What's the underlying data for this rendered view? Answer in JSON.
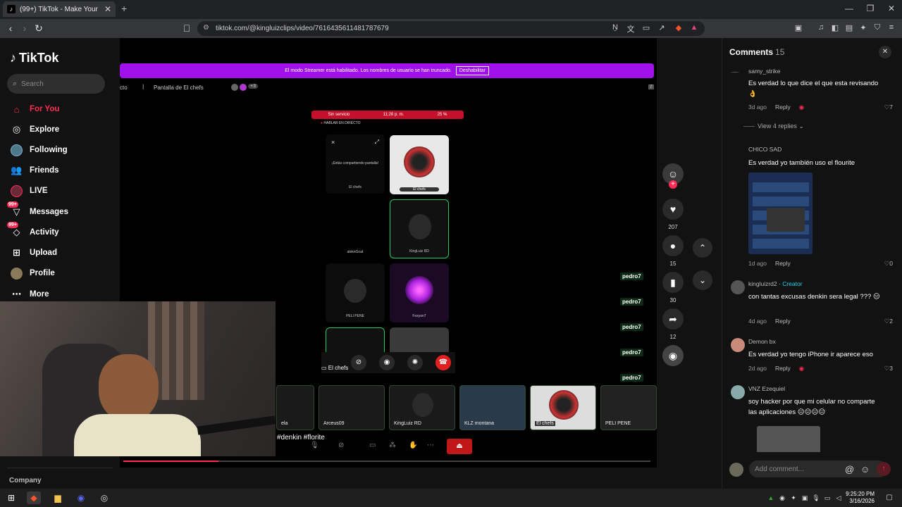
{
  "browser": {
    "tab_title": "(99+) TikTok - Make Your Day",
    "url": "tiktok.com/@kingluizclips/video/7616435611481787679",
    "new_tab": "+",
    "win_min": "—",
    "win_max": "❐",
    "win_close": "✕"
  },
  "sidebar": {
    "logo": "TikTok",
    "search_placeholder": "Search",
    "items": [
      {
        "label": "For You",
        "icon": "home-icon"
      },
      {
        "label": "Explore",
        "icon": "compass-icon"
      },
      {
        "label": "Following",
        "icon": "following-avatar-icon"
      },
      {
        "label": "Friends",
        "icon": "friends-icon"
      },
      {
        "label": "LIVE",
        "icon": "live-icon"
      },
      {
        "label": "Messages",
        "icon": "messages-icon",
        "badge": "99+"
      },
      {
        "label": "Activity",
        "icon": "activity-icon",
        "badge": "99+"
      },
      {
        "label": "Upload",
        "icon": "upload-icon"
      },
      {
        "label": "Profile",
        "icon": "profile-avatar-icon"
      },
      {
        "label": "More",
        "icon": "more-icon"
      }
    ],
    "company": "Company"
  },
  "video": {
    "banner_text": "El modo Streamer está habilitado. Los nombres de usuario se han truncado.",
    "banner_button": "Deshabilitar",
    "stream_left": "cto",
    "screen_label": "Pantalla de El chefs",
    "viewer_extra": "+3",
    "corner_badge": "7",
    "phone_status_left": "Sin servicio",
    "phone_status_time": "11:28 p. m.",
    "phone_status_right": "25 %",
    "hablar": "HABLAR EN DIRECTO",
    "sharing_text": "¡Estás compartiendo pantalla!",
    "sharing_user": "El chefs",
    "tile_el_chefs": "El chefs",
    "tile_kingluiz": "KingLuiz RD",
    "tile_alekn": "aleknGoat",
    "tile_peli": "PELI PENE",
    "tile_foxyon": "Foxyon7",
    "call_name": "El chefs",
    "strip_names": [
      "pedro7",
      "pedro7",
      "pedro7",
      "pedro7",
      "pedro7"
    ],
    "bottom_tiles": [
      "ela",
      "Arceus09",
      "KingLuiz RD",
      "KLZ montana",
      "El chefs",
      "PELI PENE"
    ],
    "hashtags": "#denkin #florite"
  },
  "actions": {
    "likes": "207",
    "comments": "15",
    "saves": "30",
    "shares": "12"
  },
  "comments_panel": {
    "title": "Comments",
    "count": "15",
    "view_replies": "View 4 replies",
    "reply": "Reply",
    "creator_label": "Creator",
    "add_placeholder": "Add comment...",
    "list": [
      {
        "user": "samy_strike",
        "text": "Es verdad lo que dice el que esta revisando 👌",
        "age": "3d ago",
        "likes": "7"
      },
      {
        "user": "CHICO SAD",
        "text": "Es verdad yo también uso el flourite",
        "age": "1d ago",
        "likes": "0"
      },
      {
        "user": "kingluizrd2",
        "text": "con tantas excusas denkin sera legal ??? 😑",
        "age": "4d ago",
        "likes": "2"
      },
      {
        "user": "Demon bx",
        "text": "Es verdad yo tengo iPhone ir aparece eso",
        "age": "2d ago",
        "likes": "3"
      },
      {
        "user": "VNZ Ezequiel",
        "text": "soy hacker por que mi celular no comparte las aplicaciones 😑😑😑😑",
        "age": "",
        "likes": ""
      }
    ]
  },
  "taskbar": {
    "time": "9:25:20 PM",
    "date": "3/16/2026"
  },
  "colors": {
    "accent": "#fe2c55",
    "banner": "#a010e8",
    "creator": "#20d5ec"
  }
}
